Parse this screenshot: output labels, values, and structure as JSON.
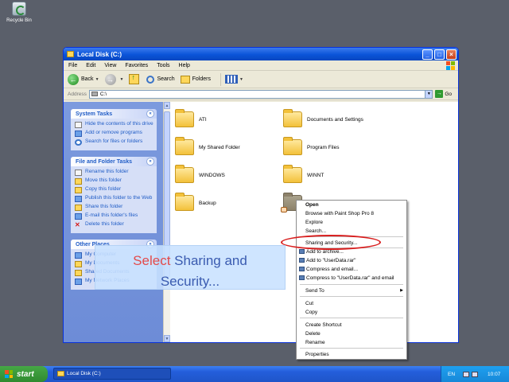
{
  "desktop": {
    "recycle_bin_label": "Recycle Bin"
  },
  "window": {
    "title": "Local Disk (C:)",
    "caption_buttons": {
      "minimize": "_",
      "maximize": "□",
      "close": "×"
    }
  },
  "menubar": [
    "File",
    "Edit",
    "View",
    "Favorites",
    "Tools",
    "Help"
  ],
  "toolbar": {
    "back": "Back",
    "search": "Search",
    "folders": "Folders"
  },
  "address": {
    "label": "Address",
    "value": "C:\\",
    "go": "Go"
  },
  "taskpane": {
    "system_tasks": {
      "title": "System Tasks",
      "items": [
        "Hide the contents of this drive",
        "Add or remove programs",
        "Search for files or folders"
      ]
    },
    "file_folder_tasks": {
      "title": "File and Folder Tasks",
      "items": [
        "Rename this folder",
        "Move this folder",
        "Copy this folder",
        "Publish this folder to the Web",
        "Share this folder",
        "E-mail this folder's files",
        "Delete this folder"
      ]
    },
    "other_places": {
      "title": "Other Places",
      "items": [
        "My Computer",
        "My Documents",
        "Shared Documents",
        "My Network Places"
      ]
    }
  },
  "files": [
    {
      "name": "ATI"
    },
    {
      "name": "Documents and Settings"
    },
    {
      "name": "My Shared Folder"
    },
    {
      "name": "Program Files"
    },
    {
      "name": "WINDOWS"
    },
    {
      "name": "WINNT"
    },
    {
      "name": "Backup"
    },
    {
      "name": ""
    }
  ],
  "context_menu": {
    "items": [
      "Open",
      "Browse with Paint Shop Pro 8",
      "Explore",
      "Search...",
      "Sharing and Security...",
      "Add to archive...",
      "Add to \"UserData.rar\"",
      "Compress and email...",
      "Compress to \"UserData.rar\" and email",
      "Send To",
      "Cut",
      "Copy",
      "Create Shortcut",
      "Delete",
      "Rename",
      "Properties"
    ]
  },
  "callout": {
    "highlight": "Select",
    "rest_line1": " Sharing and",
    "line2": "Security..."
  },
  "taskbar": {
    "start": "start",
    "task": "Local Disk (C:)",
    "language": "EN",
    "clock": "10:07"
  },
  "colors": {
    "titlebar": "#0a54d8",
    "taskpane": "#7c9ade",
    "highlight_ellipse": "#d81f1f",
    "callout_text": "#3a5bb0",
    "callout_highlight": "#e34a4a"
  }
}
